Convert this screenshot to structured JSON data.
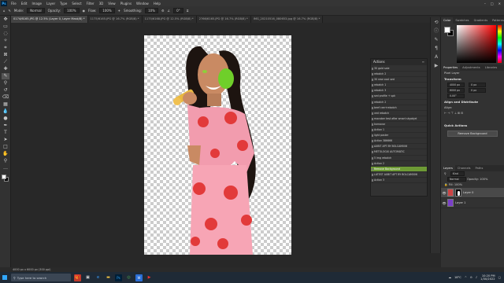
{
  "menubar": {
    "logo": "Ps",
    "items": [
      "File",
      "Edit",
      "Image",
      "Layer",
      "Type",
      "Select",
      "Filter",
      "3D",
      "View",
      "Plugins",
      "Window",
      "Help"
    ],
    "window_controls": [
      "–",
      "□",
      "✕"
    ]
  },
  "optbar": {
    "mode_label": "Mode:",
    "mode_value": "Normal",
    "opacity_label": "Opacity:",
    "opacity_value": "100%",
    "flow_label": "Flow:",
    "flow_value": "100%",
    "smoothing_label": "Smoothing:",
    "smoothing_value": "10%",
    "angle_value": "0°"
  },
  "tabs": [
    {
      "label": "0174/6165.JPG @ 12.5% (Layer 0, Layer Mask/8) *",
      "active": true
    },
    {
      "label": "1175/6165.JPG @ 16.7% (RGB/8) *",
      "active": false
    },
    {
      "label": "1175/6168.JPG @ 12.5% (RGB/8) *",
      "active": false
    },
    {
      "label": "2766/6165.JPG @ 16.7% (RGB/8) *",
      "active": false
    },
    {
      "label": "IMG_20210516_080653.jpg @ 16.7% (RGB/8) *",
      "active": false
    }
  ],
  "actions": {
    "title": "Actions",
    "items": [
      {
        "label": "30 gold sale"
      },
      {
        "label": "rebotch 2"
      },
      {
        "label": "30 new cool sed"
      },
      {
        "label": "rebatch 1"
      },
      {
        "label": "rebatch 3"
      },
      {
        "label": "sed profile + spk"
      },
      {
        "label": "rebotch 2"
      },
      {
        "label": "beef cee+rebotch"
      },
      {
        "label": "ved rebatch"
      },
      {
        "label": "macaber test after smart skyobjet"
      },
      {
        "label": "karnavar"
      },
      {
        "label": "Action 1"
      },
      {
        "label": "light poster"
      },
      {
        "label": "Action 386666"
      },
      {
        "label": "AXBIT APT BY BOLCAM006"
      },
      {
        "label": "METOLOGIX AUTOMATIC"
      },
      {
        "label": "5 img rebotch"
      },
      {
        "label": "Action 2"
      },
      {
        "label": "Remove Background"
      },
      {
        "label": "LATEST AXBIT APT BY BOLCAM006"
      },
      {
        "label": "Action 3"
      }
    ],
    "selected_index": 18
  },
  "colorpanel": {
    "tabs": [
      "Color",
      "Swatches",
      "Gradients",
      "Patterns"
    ]
  },
  "properties": {
    "tabs": [
      "Properties",
      "Adjustments",
      "Libraries"
    ],
    "layer_type": "Pixel Layer",
    "transform_title": "Transform",
    "w_value": "4000 px",
    "h_value": "6000 px",
    "x_value": "0 px",
    "y_value": "0 px",
    "angle_value": "0.00°",
    "align_title": "Align and Distribute",
    "align_sub": "Align:",
    "quick_title": "Quick Actions",
    "remove_bg_button": "Remove Background"
  },
  "layers": {
    "tabs": [
      "Layers",
      "Channels",
      "Paths"
    ],
    "kind_label": "Kind",
    "blend_mode": "Normal",
    "opacity_label": "Opacity:",
    "opacity_value": "100%",
    "fill_label": "Fill:",
    "fill_value": "100%",
    "rows": [
      {
        "name": "Layer 0"
      },
      {
        "name": "Layer 1"
      }
    ]
  },
  "status": {
    "text": "4000 px x 6000 px (300 ppi)"
  },
  "taskbar": {
    "search_placeholder": "Type here to search",
    "weather": "18°C",
    "time": "10:20 PM",
    "date": "1/30/2022"
  }
}
